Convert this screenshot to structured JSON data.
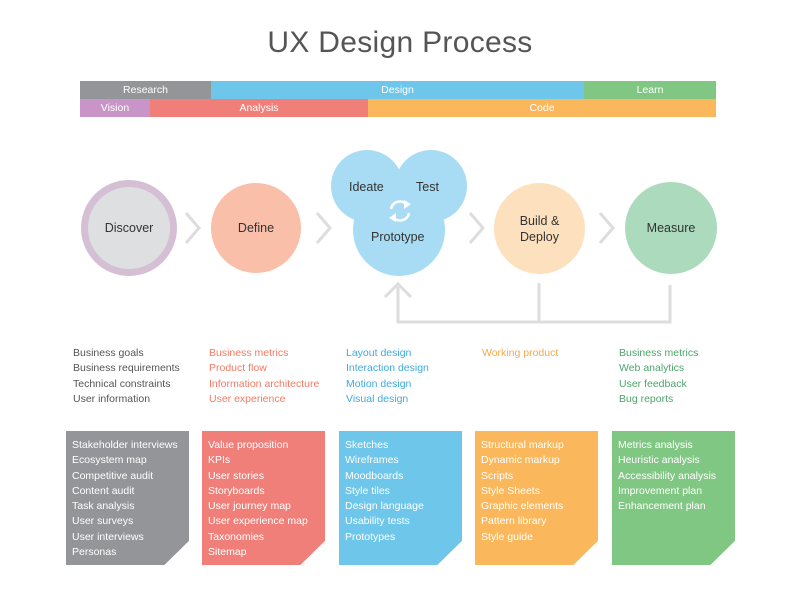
{
  "title": "UX Design Process",
  "colors": {
    "gray": "#939598",
    "purple": "#c994c7",
    "red": "#f07f79",
    "blue": "#6ec6ea",
    "orange": "#fbb75b",
    "green": "#81c784",
    "connector": "#dddddd"
  },
  "phase_bars": {
    "top": [
      {
        "label": "Research",
        "color": "#939598"
      },
      {
        "label": "Design",
        "color": "#6ec6ea"
      },
      {
        "label": "Learn",
        "color": "#81c784"
      }
    ],
    "bottom": [
      {
        "label": "Vision",
        "color": "#c994c7"
      },
      {
        "label": "Analysis",
        "color": "#f07f79"
      },
      {
        "label": "Code",
        "color": "#fbb75b"
      }
    ]
  },
  "stages": [
    {
      "label": "Discover",
      "fill": "#dedfe0",
      "ring": "#d5bfd5"
    },
    {
      "label": "Define",
      "fill": "#f9bfa9"
    },
    {
      "label_ideate": "Ideate",
      "label_test": "Test",
      "label_prototype": "Prototype",
      "fill": "#a8dcf5",
      "icon": "refresh-cycle"
    },
    {
      "label_line1": "Build &",
      "label_line2": "Deploy",
      "fill": "#fde0bd"
    },
    {
      "label": "Measure",
      "fill": "#acdabd"
    }
  ],
  "outputs": [
    {
      "color": "#555555",
      "items": [
        "Business goals",
        "Business requirements",
        "Technical constraints",
        "User information"
      ]
    },
    {
      "color": "#f37a63",
      "items": [
        "Business metrics",
        "Product flow",
        "Information architecture",
        "User experience"
      ]
    },
    {
      "color": "#3fa9dc",
      "items": [
        "Layout design",
        "Interaction design",
        "Motion design",
        "Visual design"
      ]
    },
    {
      "color": "#f5a947",
      "items": [
        "Working product"
      ]
    },
    {
      "color": "#4ea46a",
      "items": [
        "Business metrics",
        "Web analytics",
        "User feedback",
        "Bug reports"
      ]
    }
  ],
  "deliverables": [
    {
      "color": "#939598",
      "items": [
        "Stakeholder interviews",
        "Ecosystem map",
        "Competitive audit",
        "Content audit",
        "Task analysis",
        "User surveys",
        "User interviews",
        "Personas"
      ]
    },
    {
      "color": "#f07f79",
      "items": [
        "Value proposition",
        "KPIs",
        "User stories",
        "Storyboards",
        "User journey map",
        "User experience map",
        "Taxonomies",
        "Sitemap"
      ]
    },
    {
      "color": "#6ec6ea",
      "items": [
        "Sketches",
        "Wireframes",
        "Moodboards",
        "Style tiles",
        "Design language",
        "Usability tests",
        "Prototypes"
      ]
    },
    {
      "color": "#fbb75b",
      "items": [
        "Structural markup",
        "Dynamic markup",
        "Scripts",
        "Style Sheets",
        "Graphic elements",
        "Pattern library",
        "Style guide"
      ]
    },
    {
      "color": "#81c784",
      "items": [
        "Metrics analysis",
        "Heuristic analysis",
        "Accessibility analysis",
        "Improvement plan",
        "Enhancement plan"
      ]
    }
  ]
}
